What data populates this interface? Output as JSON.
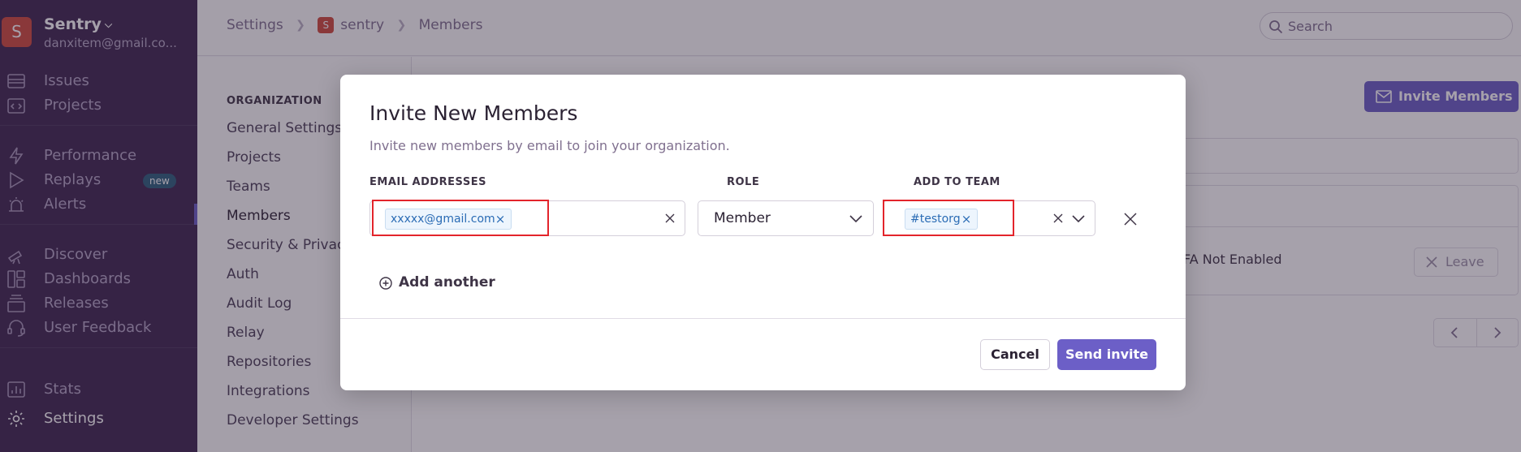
{
  "colors": {
    "sidebar_bg": "#3e2650",
    "accent": "#6c5fc7",
    "org_avatar": "#cf4a3d",
    "chip_text": "#2b6cb5",
    "highlight_border": "#e3242b",
    "new_badge": "#2e5f7c"
  },
  "org": {
    "avatar_letter": "S",
    "name": "Sentry",
    "email": "danxitem@gmail.co..."
  },
  "sidebar": {
    "items": [
      {
        "label": "Issues",
        "icon": "issues-icon"
      },
      {
        "label": "Projects",
        "icon": "projects-icon"
      },
      {
        "label": "Performance",
        "icon": "performance-icon"
      },
      {
        "label": "Replays",
        "icon": "replays-icon",
        "badge": "new"
      },
      {
        "label": "Alerts",
        "icon": "alerts-icon"
      },
      {
        "label": "Discover",
        "icon": "discover-icon"
      },
      {
        "label": "Dashboards",
        "icon": "dashboards-icon"
      },
      {
        "label": "Releases",
        "icon": "releases-icon"
      },
      {
        "label": "User Feedback",
        "icon": "user-feedback-icon"
      },
      {
        "label": "Stats",
        "icon": "stats-icon"
      },
      {
        "label": "Settings",
        "icon": "settings-icon",
        "active": true
      }
    ]
  },
  "breadcrumb": {
    "items": [
      "Settings",
      "sentry",
      "Members"
    ],
    "project_avatar_letter": "S"
  },
  "search": {
    "placeholder": "Search",
    "icon": "search-icon"
  },
  "settings_nav": {
    "heading": "ORGANIZATION",
    "items": [
      "General Settings",
      "Projects",
      "Teams",
      "Members",
      "Security & Privacy",
      "Auth",
      "Audit Log",
      "Relay",
      "Repositories",
      "Integrations",
      "Developer Settings"
    ],
    "active": "Members"
  },
  "main": {
    "invite_members_label": "Invite Members",
    "tfa_status": "FA Not Enabled",
    "leave_label": "Leave"
  },
  "modal": {
    "title": "Invite New Members",
    "subtitle": "Invite new members by email to join your organization.",
    "columns": {
      "email": "EMAIL ADDRESSES",
      "role": "ROLE",
      "team": "ADD TO TEAM"
    },
    "row": {
      "email_chip": "xxxxx@gmail.com",
      "role": "Member",
      "team_chip": "#testorg"
    },
    "add_another_label": "Add another",
    "cancel_label": "Cancel",
    "send_label": "Send invite"
  }
}
